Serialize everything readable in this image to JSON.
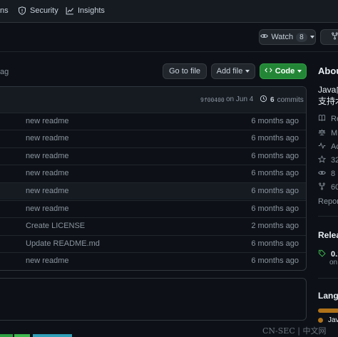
{
  "topnav": {
    "items": [
      {
        "label": "ns",
        "icon": "play-icon"
      },
      {
        "label": "Security",
        "icon": "shield-icon"
      },
      {
        "label": "Insights",
        "icon": "graph-icon"
      }
    ]
  },
  "repo_actions": {
    "watch_label": "Watch",
    "watch_count": "8"
  },
  "file_nav": {
    "tag_text": "ag",
    "go_to_file": "Go to file",
    "add_file": "Add file",
    "code": "Code"
  },
  "latest_commit": {
    "hash": "9f00400",
    "date": "on Jun 4",
    "commit_count": "6",
    "commits_label": "commits"
  },
  "files": [
    {
      "message": "new readme",
      "age": "6 months ago"
    },
    {
      "message": "new readme",
      "age": "6 months ago"
    },
    {
      "message": "new readme",
      "age": "6 months ago"
    },
    {
      "message": "new readme",
      "age": "6 months ago"
    },
    {
      "message": "new readme",
      "age": "6 months ago"
    },
    {
      "message": "new readme",
      "age": "6 months ago"
    },
    {
      "message": "Create LICENSE",
      "age": "2 months ago"
    },
    {
      "message": "Update README.md",
      "age": "6 months ago"
    },
    {
      "message": "new readme",
      "age": "6 months ago"
    }
  ],
  "about": {
    "title": "About",
    "desc_line1": "Java内",
    "desc_line2": "支持木",
    "stats": [
      {
        "icon": "book-icon",
        "text": "Re"
      },
      {
        "icon": "scale-icon",
        "text": "MI"
      },
      {
        "icon": "pulse-icon",
        "text": "Ac"
      },
      {
        "icon": "star-icon",
        "text": "32"
      },
      {
        "icon": "eye-icon",
        "text": "8"
      },
      {
        "icon": "fork-icon",
        "text": "60"
      }
    ],
    "report": "Report"
  },
  "releases": {
    "title": "Releas",
    "tag": "0.1",
    "date": "on"
  },
  "languages": {
    "title": "Langu",
    "first": "Jav"
  },
  "watermark": "CN-SEC | 中文网",
  "colors": {
    "bg": "#0d1117",
    "accent_green": "#238636",
    "java": "#b07219"
  }
}
